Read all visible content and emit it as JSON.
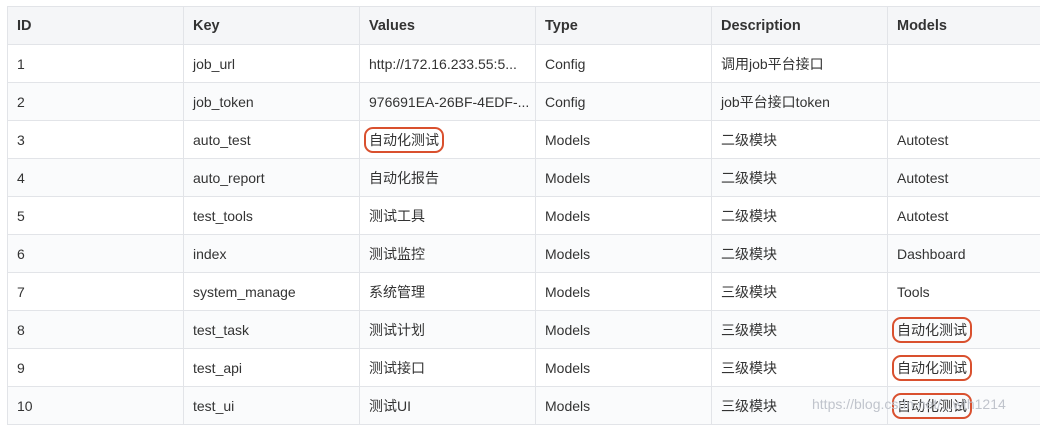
{
  "headers": [
    "ID",
    "Key",
    "Values",
    "Type",
    "Description",
    "Models"
  ],
  "rows": [
    {
      "id": "1",
      "key": "job_url",
      "value": "http://172.16.233.55:5...",
      "type": "Config",
      "desc": "调用job平台接口",
      "models": ""
    },
    {
      "id": "2",
      "key": "job_token",
      "value": "976691EA-26BF-4EDF-...",
      "type": "Config",
      "desc": "job平台接口token",
      "models": ""
    },
    {
      "id": "3",
      "key": "auto_test",
      "value": "自动化测试",
      "type": "Models",
      "desc": "二级模块",
      "models": "Autotest"
    },
    {
      "id": "4",
      "key": "auto_report",
      "value": "自动化报告",
      "type": "Models",
      "desc": "二级模块",
      "models": "Autotest"
    },
    {
      "id": "5",
      "key": "test_tools",
      "value": "测试工具",
      "type": "Models",
      "desc": "二级模块",
      "models": "Autotest"
    },
    {
      "id": "6",
      "key": "index",
      "value": "测试监控",
      "type": "Models",
      "desc": "二级模块",
      "models": "Dashboard"
    },
    {
      "id": "7",
      "key": "system_manage",
      "value": "系统管理",
      "type": "Models",
      "desc": "三级模块",
      "models": "Tools"
    },
    {
      "id": "8",
      "key": "test_task",
      "value": "测试计划",
      "type": "Models",
      "desc": "三级模块",
      "models": "自动化测试"
    },
    {
      "id": "9",
      "key": "test_api",
      "value": "测试接口",
      "type": "Models",
      "desc": "三级模块",
      "models": "自动化测试"
    },
    {
      "id": "10",
      "key": "test_ui",
      "value": "测试UI",
      "type": "Models",
      "desc": "三级模块",
      "models": "自动化测试"
    }
  ],
  "highlight_color": "#d9502e",
  "watermark": "https://blog.csdn.net/...wth1214"
}
